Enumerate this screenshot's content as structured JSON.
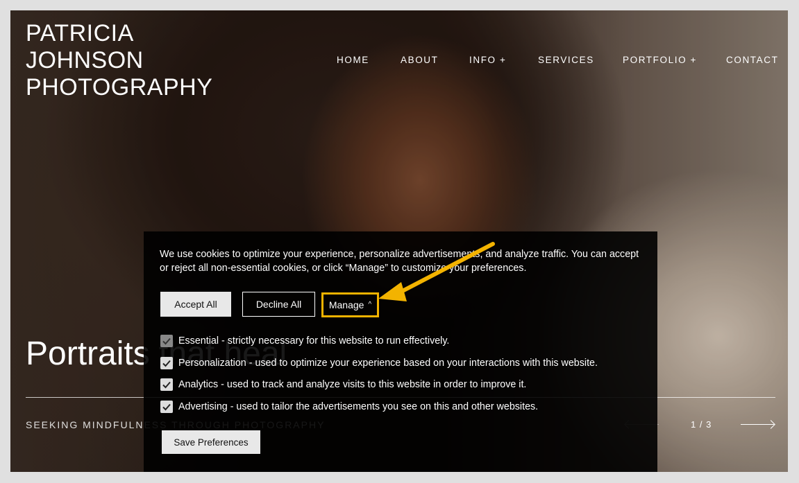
{
  "site": {
    "brand_lines": [
      "PATRICIA",
      "JOHNSON",
      "PHOTOGRAPHY"
    ],
    "nav": [
      {
        "label": "HOME"
      },
      {
        "label": "ABOUT"
      },
      {
        "label": "INFO +"
      },
      {
        "label": "SERVICES"
      },
      {
        "label": "PORTFOLIO +"
      },
      {
        "label": "CONTACT"
      }
    ]
  },
  "hero": {
    "title": "Portraits that heal",
    "tagline": "SEEKING MINDFULNESS THROUGH PHOTOGRAPHY",
    "pager": "1 / 3"
  },
  "cookie_banner": {
    "message": "We use cookies to optimize your experience, personalize advertisements, and analyze traffic. You can accept or reject all non-essential cookies, or click “Manage” to customize your preferences.",
    "accept_label": "Accept All",
    "decline_label": "Decline All",
    "manage_label": "Manage",
    "manage_chevron": "^",
    "options": [
      {
        "label": "Essential - strictly necessary for this website to run effectively.",
        "checked": true,
        "disabled": true
      },
      {
        "label": "Personalization - used to optimize your experience based on your interactions with this website.",
        "checked": true,
        "disabled": false
      },
      {
        "label": "Analytics - used to track and analyze visits to this website in order to improve it.",
        "checked": true,
        "disabled": false
      },
      {
        "label": "Advertising - used to tailor the advertisements you see on this and other websites.",
        "checked": true,
        "disabled": false
      }
    ],
    "save_label": "Save Preferences"
  },
  "colors": {
    "highlight": "#f3b300",
    "banner_bg": "#000000"
  }
}
